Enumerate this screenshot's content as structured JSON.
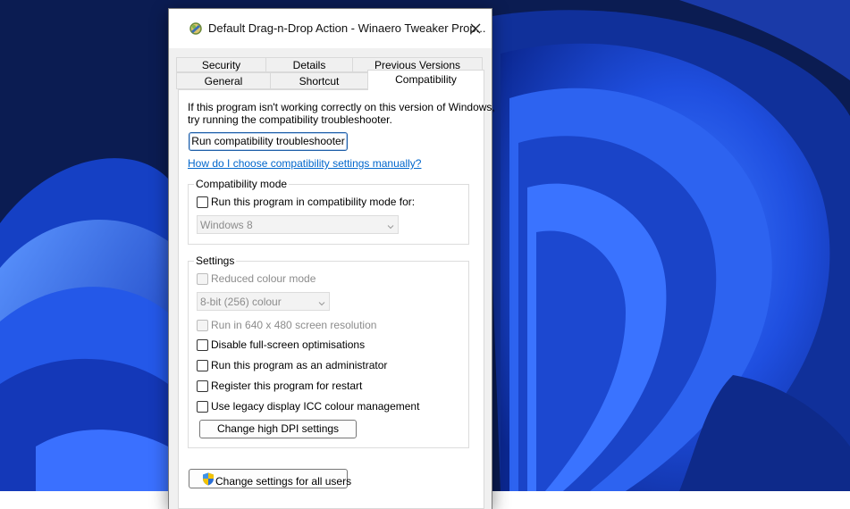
{
  "window": {
    "title": "Default Drag-n-Drop Action - Winaero Tweaker Prop..."
  },
  "tabs": {
    "row1": [
      {
        "label": "Security"
      },
      {
        "label": "Details"
      },
      {
        "label": "Previous Versions"
      }
    ],
    "row2": [
      {
        "label": "General"
      },
      {
        "label": "Shortcut"
      },
      {
        "label": "Compatibility",
        "active": true
      }
    ]
  },
  "compat": {
    "intro_line1": "If this program isn't working correctly on this version of Windows,",
    "intro_line2": "try running the compatibility troubleshooter.",
    "troubleshooter_button": "Run compatibility troubleshooter",
    "help_link": "How do I choose compatibility settings manually?",
    "mode_group": {
      "legend": "Compatibility mode",
      "checkbox_label": "Run this program in compatibility mode for:",
      "checked": false,
      "select_value": "Windows 8"
    },
    "settings_group": {
      "legend": "Settings",
      "reduced_colour": {
        "label": "Reduced colour mode",
        "checked": false,
        "disabled": true
      },
      "colour_select_value": "8-bit (256) colour",
      "resolution": {
        "label": "Run in 640 x 480 screen resolution",
        "checked": false,
        "disabled": true
      },
      "fullscreen": {
        "label": "Disable full-screen optimisations",
        "checked": false
      },
      "admin": {
        "label": "Run this program as an administrator",
        "checked": false
      },
      "restart": {
        "label": "Register this program for restart",
        "checked": false
      },
      "icc": {
        "label": "Use legacy display ICC colour management",
        "checked": false
      },
      "dpi_button": "Change high DPI settings"
    },
    "all_users_button": "Change settings for all users"
  },
  "icons": {
    "app": "winaero-app-icon",
    "close": "close-icon",
    "shield": "uac-shield-icon",
    "chevron": "chevron-down-icon"
  },
  "colors": {
    "accent": "#0066cc",
    "wallpaper": "#0a1a4a"
  }
}
